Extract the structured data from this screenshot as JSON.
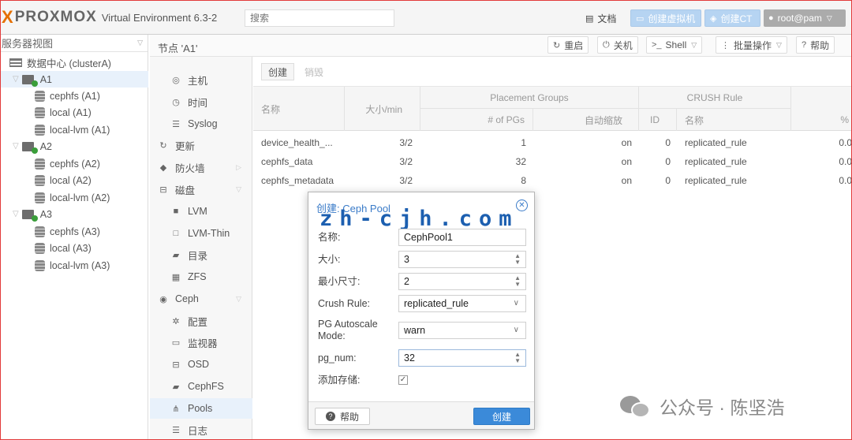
{
  "header": {
    "brand_x": "X",
    "brand_word": "PROXMOX",
    "version": "Virtual Environment 6.3-2",
    "search_placeholder": "搜索",
    "docs": "文档",
    "create_vm": "创建虚拟机",
    "create_ct": "创建CT",
    "user": "root@pam"
  },
  "left": {
    "view": "服务器视图",
    "items": [
      {
        "label": "数据中心 (clusterA)"
      },
      {
        "label": "A1"
      },
      {
        "label": "cephfs (A1)"
      },
      {
        "label": "local (A1)"
      },
      {
        "label": "local-lvm (A1)"
      },
      {
        "label": "A2"
      },
      {
        "label": "cephfs (A2)"
      },
      {
        "label": "local (A2)"
      },
      {
        "label": "local-lvm (A2)"
      },
      {
        "label": "A3"
      },
      {
        "label": "cephfs (A3)"
      },
      {
        "label": "local (A3)"
      },
      {
        "label": "local-lvm (A3)"
      }
    ]
  },
  "content": {
    "title": "节点 'A1'",
    "restart": "重启",
    "shutdown": "关机",
    "shell": "Shell",
    "bulk": "批量操作",
    "help": "帮助"
  },
  "nav": {
    "items": [
      {
        "label": "主机"
      },
      {
        "label": "时间"
      },
      {
        "label": "Syslog"
      },
      {
        "label": "更新"
      },
      {
        "label": "防火墙"
      },
      {
        "label": "磁盘"
      },
      {
        "label": "LVM"
      },
      {
        "label": "LVM-Thin"
      },
      {
        "label": "目录"
      },
      {
        "label": "ZFS"
      },
      {
        "label": "Ceph"
      },
      {
        "label": "配置"
      },
      {
        "label": "监视器"
      },
      {
        "label": "OSD"
      },
      {
        "label": "CephFS"
      },
      {
        "label": "Pools"
      },
      {
        "label": "日志"
      }
    ]
  },
  "grid": {
    "create": "创建",
    "destroy": "销毁",
    "headers": {
      "name": "名称",
      "size": "大小/min",
      "pg_group": "Placement Groups",
      "pgs": "# of PGs",
      "autoscale": "自动缩放",
      "crush_group": "CRUSH Rule",
      "crush_id": "ID",
      "crush_name": "名称",
      "more": "%"
    },
    "rows": [
      {
        "name": "device_health_...",
        "size": "3/2",
        "pgs": "1",
        "autoscale": "on",
        "id": "0",
        "rule": "replicated_rule",
        "used": "0.0"
      },
      {
        "name": "cephfs_data",
        "size": "3/2",
        "pgs": "32",
        "autoscale": "on",
        "id": "0",
        "rule": "replicated_rule",
        "used": "0.0"
      },
      {
        "name": "cephfs_metadata",
        "size": "3/2",
        "pgs": "8",
        "autoscale": "on",
        "id": "0",
        "rule": "replicated_rule",
        "used": "0.0"
      }
    ]
  },
  "dialog": {
    "title": "创建: Ceph Pool",
    "watermark": "zh-cjh.com",
    "fields": {
      "name_label": "名称:",
      "name_value": "CephPool1",
      "size_label": "大小:",
      "size_value": "3",
      "minsize_label": "最小尺寸:",
      "minsize_value": "2",
      "crush_label": "Crush Rule:",
      "crush_value": "replicated_rule",
      "autoscale_label": "PG Autoscale Mode:",
      "autoscale_value": "warn",
      "pgnum_label": "pg_num:",
      "pgnum_value": "32",
      "addstorage_label": "添加存储:"
    },
    "help": "帮助",
    "create": "创建"
  },
  "watermark_wechat": "公众号 · 陈坚浩",
  "colors": {
    "accent_blue": "#3b8ad9",
    "brand_orange": "#e57000",
    "frame_red": "#e23a3a"
  }
}
